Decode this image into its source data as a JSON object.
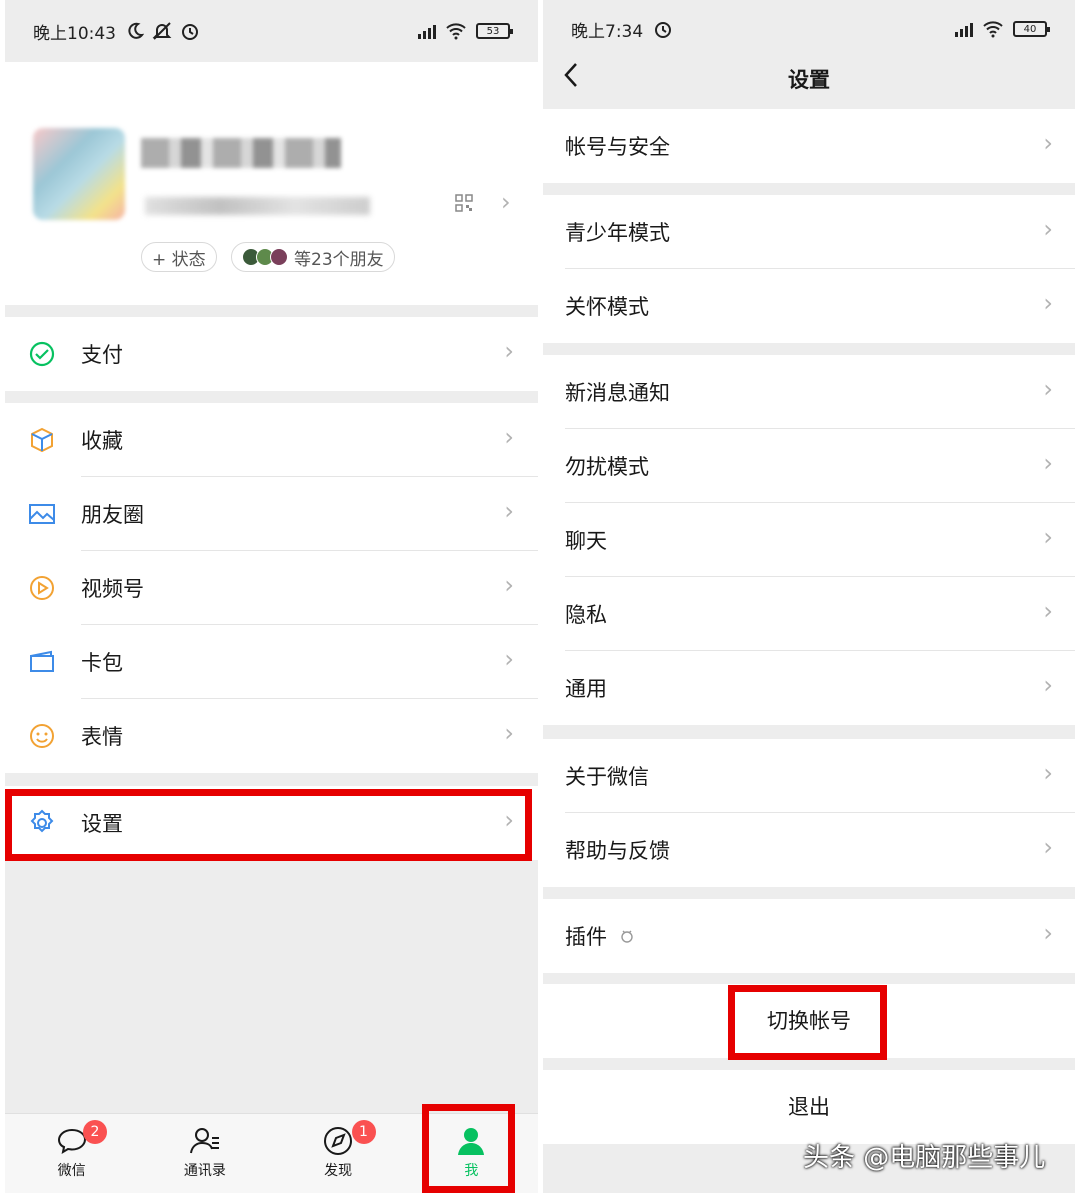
{
  "left": {
    "status": {
      "time": "晚上10:43",
      "battery": "53"
    },
    "profile": {
      "status_pill": "+ 状态",
      "friends_pill": "等23个朋友"
    },
    "menu": {
      "pay": "支付",
      "favorites": "收藏",
      "moments": "朋友圈",
      "channels": "视频号",
      "cards": "卡包",
      "stickers": "表情",
      "settings": "设置"
    },
    "tabs": [
      {
        "label": "微信",
        "badge": "2"
      },
      {
        "label": "通讯录"
      },
      {
        "label": "发现",
        "badge": "1"
      },
      {
        "label": "我"
      }
    ]
  },
  "right": {
    "status": {
      "time": "晚上7:34",
      "battery": "40"
    },
    "title": "设置",
    "items": {
      "account_security": "帐号与安全",
      "teen_mode": "青少年模式",
      "care_mode": "关怀模式",
      "notifications": "新消息通知",
      "do_not_disturb": "勿扰模式",
      "chat": "聊天",
      "privacy": "隐私",
      "general": "通用",
      "about": "关于微信",
      "help_feedback": "帮助与反馈",
      "plugins": "插件"
    },
    "switch_account": "切换帐号",
    "logout": "退出"
  },
  "watermark": "头条 @电脑那些事儿",
  "colors": {
    "wechat_green": "#07c160",
    "highlight_red": "#e60000",
    "badge_red": "#fa5151"
  }
}
